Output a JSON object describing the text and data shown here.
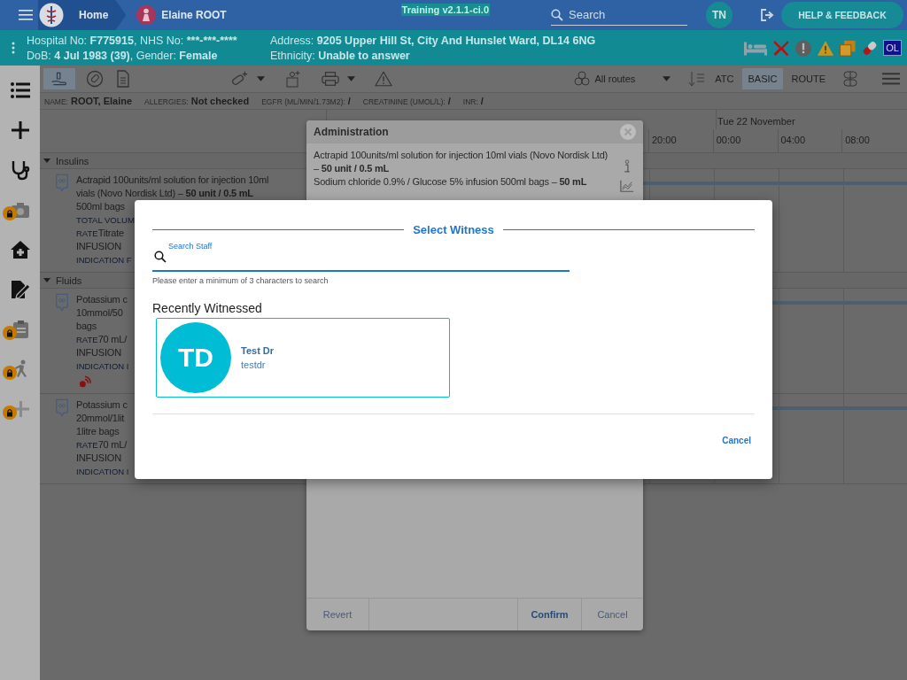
{
  "header": {
    "home": "Home",
    "patient_name": "Elaine ROOT",
    "environment": "Training v2.1.1-ci.0",
    "search": {
      "placeholder": "Search"
    },
    "user_initials": "TN",
    "help_button": "HELP & FEEDBACK"
  },
  "patient_bar": {
    "left": [
      [
        {
          "label": "Hospital No:",
          "value": "F775915"
        },
        {
          "label": ", NHS No:",
          "value": "***-***-****"
        }
      ],
      [
        {
          "label": "DoB:",
          "value": "4 Jul 1983 (39)"
        },
        {
          "label": ", Gender:",
          "value": "Female"
        }
      ]
    ],
    "right": [
      [
        {
          "label": "Address:",
          "value": "9205 Upper Hill St, City And Hunslet Ward, DL14 6NG"
        }
      ],
      [
        {
          "label": "Ethnicity:",
          "value": "Unable to answer"
        }
      ]
    ],
    "badge": "OL"
  },
  "sidebar": [
    {
      "kind": "list",
      "locked": false
    },
    {
      "kind": "add",
      "locked": false
    },
    {
      "kind": "stethoscope",
      "locked": false
    },
    {
      "kind": "camera",
      "locked": true
    },
    {
      "kind": "house",
      "locked": false
    },
    {
      "kind": "edit",
      "locked": false
    },
    {
      "kind": "clipboard",
      "locked": true
    },
    {
      "kind": "runner",
      "locked": true
    },
    {
      "kind": "plus",
      "locked": true
    }
  ],
  "toolbar": {
    "first_tool_selected": true,
    "route_filter": "All routes",
    "view_modes": [
      {
        "label": "ATC",
        "selected": false
      },
      {
        "label": "BASIC",
        "selected": true
      },
      {
        "label": "ROUTE",
        "selected": false
      }
    ]
  },
  "info_bar": [
    {
      "label": "NAME:",
      "value": "ROOT, Elaine"
    },
    {
      "label": "ALLERGIES:",
      "value": "Not checked"
    },
    {
      "label": "EGFR (ML/MIN/1.73M2):",
      "value": "/"
    },
    {
      "label": "CREATININE (UMOL/L):",
      "value": "/"
    },
    {
      "label": "INR:",
      "value": "/"
    }
  ],
  "timeline": {
    "day": "Tue 22 November",
    "times": [
      "20:00",
      "00:00",
      "04:00",
      "08:00"
    ]
  },
  "groups": [
    {
      "name": "Insulins",
      "expanded": true,
      "rows": [
        {
          "lines": [
            {
              "text": "Actrapid 100units/ml solution for injection 10ml"
            },
            {
              "text": "vials (Novo Nordisk Ltd) – **50 unit / 0.5 mL**"
            },
            {
              "text": "500ml bags"
            },
            {
              "label": "TOTAL VOLUM"
            },
            {
              "label": "RATE",
              "text": "Titrate"
            },
            {
              "text": "INFUSION"
            },
            {
              "label": "INDICATION F"
            }
          ]
        }
      ]
    },
    {
      "name": "Fluids",
      "expanded": true,
      "rows": [
        {
          "alert": true,
          "lines": [
            {
              "text": "Potassium c"
            },
            {
              "text": "10mmol/50"
            },
            {
              "text": "bags"
            },
            {
              "label": "RATE",
              "text": "70 mL/"
            },
            {
              "text": "INFUSION"
            },
            {
              "label": "INDICATION I"
            }
          ]
        },
        {
          "lines": [
            {
              "text": "Potassium c"
            },
            {
              "text": "20mmol/1lit"
            },
            {
              "text": "1litre bags"
            },
            {
              "label": "RATE",
              "text": "70 mL/"
            },
            {
              "text": "INFUSION"
            },
            {
              "label": "INDICATION I"
            }
          ]
        }
      ]
    }
  ],
  "administration": {
    "title": "Administration",
    "items": [
      "Actrapid 100units/ml solution for injection 10ml vials (Novo Nordisk Ltd) – **50 unit / 0.5 mL**",
      "Sodium chloride 0.9% / Glucose 5% infusion 500ml bags – **50 mL**"
    ],
    "buttons": [
      {
        "label": "Revert",
        "primary": false
      },
      {
        "label": "Confirm",
        "primary": true
      },
      {
        "label": "Cancel",
        "primary": false
      }
    ]
  },
  "witness_dialog": {
    "title": "Select Witness",
    "search": {
      "label": "Search Staff"
    },
    "hint": "Please enter a minimum of 3 characters to search",
    "section": "Recently Witnessed",
    "staff": [
      {
        "initials": "TD",
        "name": "Test Dr",
        "username": "testdr"
      }
    ],
    "cancel": "Cancel"
  }
}
